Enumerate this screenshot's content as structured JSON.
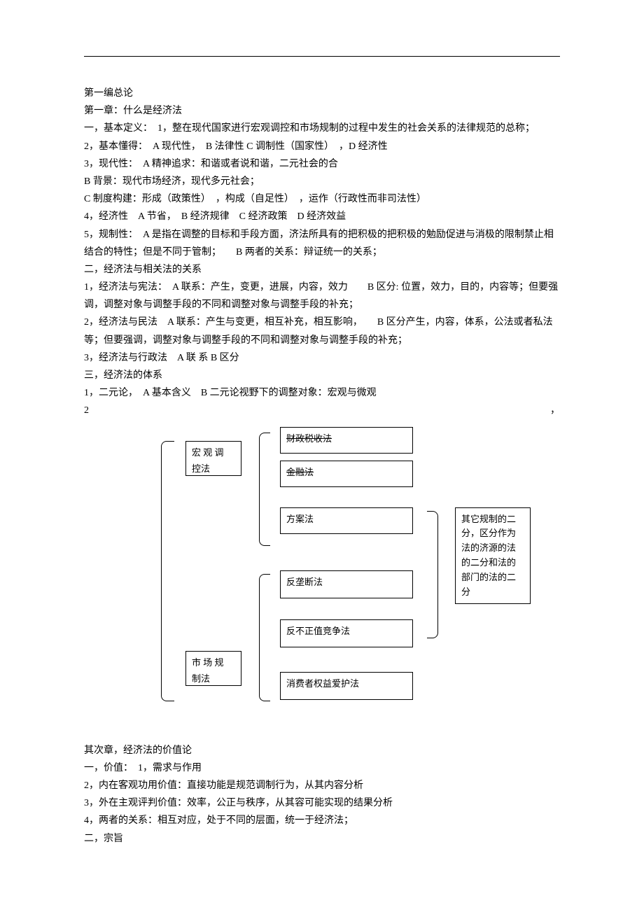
{
  "t1": "第一编总论",
  "t2": "第一章：什么是经济法",
  "t3": "一，基本定义：　1，整在现代国家进行宏观调控和市场规制的过程中发生的社会关系的法律规范的总称；",
  "t4": "2，基本懂得：　A 现代性，　B 法律性 C 调制性（国家性）　，D 经济性",
  "t5": "3，现代性：　A 精神追求：和谐或者说和谐，二元社会的合",
  "t6": "B 背景：现代市场经济，现代多元社会；",
  "t7": "C 制度构建：形成（政策性）　，构成（自足性）　，运作（行政性而非司法性）",
  "t8": "4，经济性　A 节省，　B 经济规律　C 经济政策　D 经济效益",
  "t9": "5，规制性：　A 是指在调整的目标和手段方面，济法所具有的把积极的把积极的勉励促进与消极的限制禁止相结合的特性；但是不同于管制；　　B 两者的关系：辩证统一的关系；",
  "t10": "二，经济法与相关法的关系",
  "t11": "1，经济法与宪法：　A 联系：产生，变更，进展，内容，效力　　B 区分: 位置，效力，目的，内容等；但要强调，调整对象与调整手段的不同和调整对象与调整手段的补充；",
  "t12": "2，经济法与民法　A 联系：产生与变更，相互补充，相互影响，　　B 区分产生，内容，体系，公法或者私法等；但要强调，调整对象与调整手段的不同和调整对象与调整手段的补充；",
  "t13": "3，经济法与行政法　A 联 系 B 区分",
  "t14": "三，经济法的体系",
  "t15": "1，二元论，　A 基本含义　B 二元论视野下的调整对象：宏观与微观",
  "t16": "2",
  "d1a": "宏 观 调",
  "d1b": "控法",
  "d2": "财政税收法",
  "d3": "金融法",
  "d4": "方案法",
  "d5": "反垄断法",
  "d6": "反不正值竞争法",
  "d7": "消费者权益爱护法",
  "d8a": "市 场 规",
  "d8b": "制法",
  "side": "其它规制的二分，区分作为法的济源的法的二分和法的部门的法的二分",
  "b1": "其次章，经济法的价值论",
  "b2": "一，价值：　1，需求与作用",
  "b3": "2，内在客观功用价值：直接功能是规范调制行为，从其内容分析",
  "b4": "3，外在主观评判价值：效率，公正与秩序，从其容可能实现的结果分析",
  "b5": "4，两者的关系：相互对应，处于不同的层面，统一于经济法；",
  "b6": "二，宗旨"
}
